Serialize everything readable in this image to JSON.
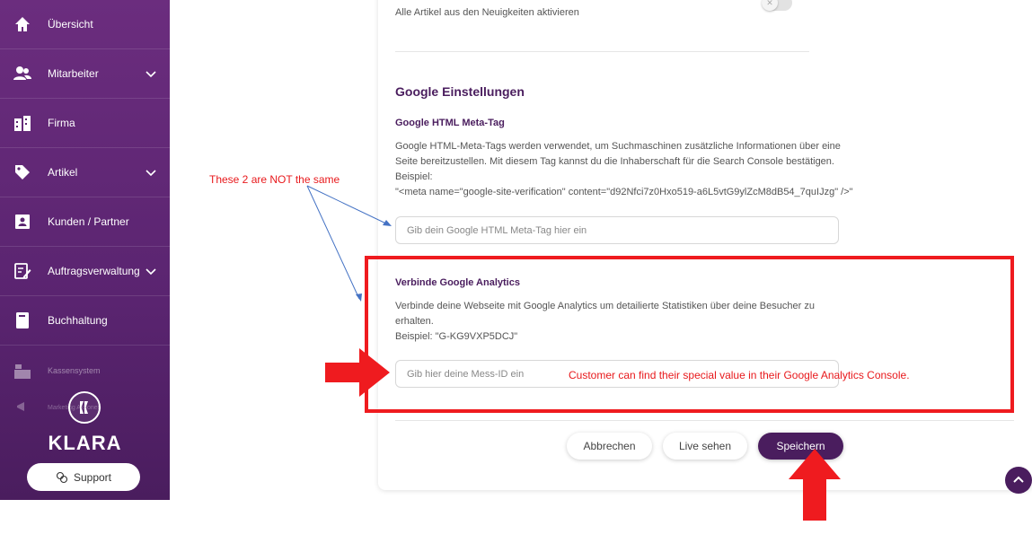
{
  "sidebar": {
    "items": [
      {
        "label": "Übersicht",
        "icon": "home-icon",
        "has_chevron": false
      },
      {
        "label": "Mitarbeiter",
        "icon": "users-icon",
        "has_chevron": true
      },
      {
        "label": "Firma",
        "icon": "building-icon",
        "has_chevron": false
      },
      {
        "label": "Artikel",
        "icon": "tag-icon",
        "has_chevron": true
      },
      {
        "label": "Kunden / Partner",
        "icon": "contact-card-icon",
        "has_chevron": false
      },
      {
        "label": "Auftragsverwaltung",
        "icon": "order-edit-icon",
        "has_chevron": true
      },
      {
        "label": "Buchhaltung",
        "icon": "book-icon",
        "has_chevron": false
      },
      {
        "label": "Kassensystem",
        "icon": "register-icon",
        "has_chevron": false
      },
      {
        "label": "Marketing Aktionen",
        "icon": "megaphone-icon",
        "has_chevron": false
      }
    ],
    "brand": "KLARA",
    "support_label": "Support"
  },
  "content": {
    "top_desc": "Alle Artikel aus den Neuigkeiten aktivieren",
    "google_settings_title": "Google Einstellungen",
    "meta_tag_title": "Google HTML Meta-Tag",
    "meta_tag_desc_1": "Google HTML-Meta-Tags werden verwendet, um Suchmaschinen zusätzliche Informationen über eine",
    "meta_tag_desc_2": "Seite bereitzustellen. Mit diesem Tag kannst du die Inhaberschaft für die Search Console bestätigen.",
    "meta_tag_desc_3": "Beispiel:",
    "meta_tag_example": "\"<meta name=\"google-site-verification\" content=\"d92Nfci7z0Hxo519-a6L5vtG9ylZcM8dB54_7quIJzg\" />\"",
    "meta_tag_placeholder": "Gib dein Google HTML Meta-Tag hier ein",
    "analytics_title": "Verbinde Google Analytics",
    "analytics_desc_1": "Verbinde deine Webseite mit Google Analytics um detailierte Statistiken über deine Besucher zu",
    "analytics_desc_2": "erhalten.",
    "analytics_example": "Beispiel: \"G-KG9VXP5DCJ\"",
    "analytics_placeholder": "Gib hier deine Mess-ID ein"
  },
  "actions": {
    "cancel": "Abbrechen",
    "live": "Live sehen",
    "save": "Speichern"
  },
  "annotations": {
    "not_same": "These 2 are NOT the same",
    "customer_note": "Customer can find their special value in their Google Analytics Console."
  },
  "colors": {
    "brand_purple": "#4a1d5e",
    "sidebar_top": "#6b2d7e",
    "annotation_red": "#ef1b1f"
  }
}
